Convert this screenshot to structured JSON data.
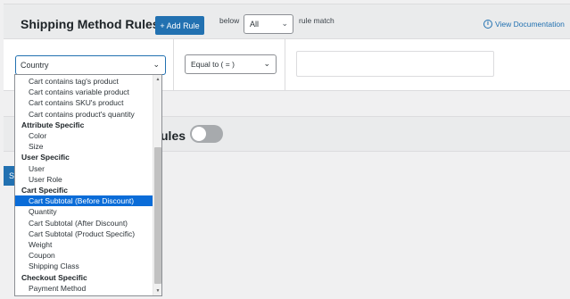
{
  "header": {
    "title": "Shipping Method Rules",
    "add_rule_label": "+ Add Rule",
    "below_label": "below",
    "below_value": "All",
    "match_label": "rule match",
    "view_doc_label": "View Documentation"
  },
  "rule": {
    "country_value": "Country",
    "operator_value": "Equal to ( = )",
    "value_input": ""
  },
  "panel2": {
    "label_fragment": "ules"
  },
  "save_button_fragment": "S",
  "dropdown": {
    "options": [
      {
        "label": "Cart contains tag's product",
        "kind": "child"
      },
      {
        "label": "Cart contains variable product",
        "kind": "child"
      },
      {
        "label": "Cart contains SKU's product",
        "kind": "child"
      },
      {
        "label": "Cart contains product's quantity",
        "kind": "child"
      },
      {
        "label": "Attribute Specific",
        "kind": "group"
      },
      {
        "label": "Color",
        "kind": "child"
      },
      {
        "label": "Size",
        "kind": "child"
      },
      {
        "label": "User Specific",
        "kind": "group"
      },
      {
        "label": "User",
        "kind": "child"
      },
      {
        "label": "User Role",
        "kind": "child"
      },
      {
        "label": "Cart Specific",
        "kind": "group"
      },
      {
        "label": "Cart Subtotal (Before Discount)",
        "kind": "child",
        "selected": true
      },
      {
        "label": "Quantity",
        "kind": "child"
      },
      {
        "label": "Cart Subtotal (After Discount)",
        "kind": "child"
      },
      {
        "label": "Cart Subtotal (Product Specific)",
        "kind": "child"
      },
      {
        "label": "Weight",
        "kind": "child"
      },
      {
        "label": "Coupon",
        "kind": "child"
      },
      {
        "label": "Shipping Class",
        "kind": "child"
      },
      {
        "label": "Checkout Specific",
        "kind": "group"
      },
      {
        "label": "Payment Method",
        "kind": "child"
      }
    ]
  },
  "colors": {
    "primary": "#2271b1",
    "selected_option": "#0a6cd8",
    "header_bg": "#eaebec"
  }
}
